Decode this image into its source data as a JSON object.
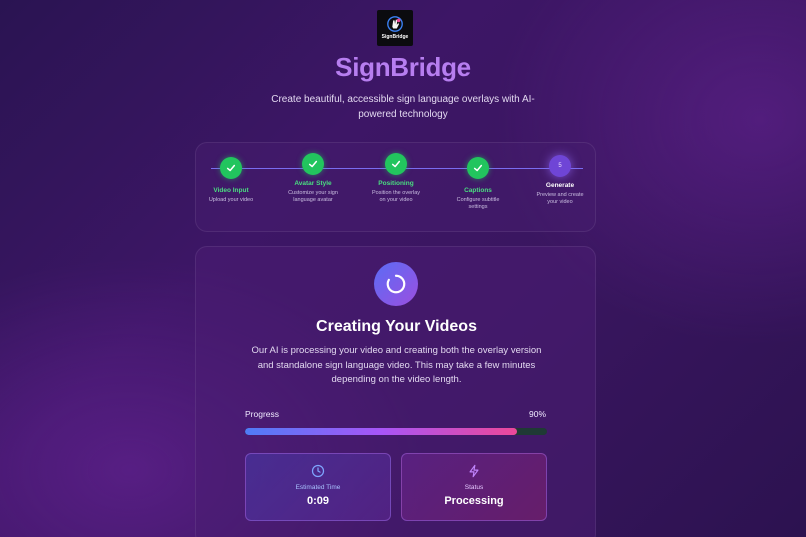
{
  "brand": {
    "logo_text": "SignBridge",
    "name": "SignBridge",
    "tagline": "Create beautiful, accessible sign language overlays with AI-powered technology"
  },
  "steps": [
    {
      "title": "Video Input",
      "desc": "Upload your video",
      "status": "complete"
    },
    {
      "title": "Avatar Style",
      "desc": "Customize your sign language avatar",
      "status": "complete"
    },
    {
      "title": "Positioning",
      "desc": "Position the overlay on your video",
      "status": "complete"
    },
    {
      "title": "Captions",
      "desc": "Configure subtitle settings",
      "status": "complete"
    },
    {
      "title": "Generate",
      "desc": "Preview and create your video",
      "status": "current",
      "number": "5"
    }
  ],
  "generation": {
    "title": "Creating Your Videos",
    "description": "Our AI is processing your video and creating both the overlay version and standalone sign language video. This may take a few minutes depending on the video length.",
    "progress_label": "Progress",
    "progress_text": "90%",
    "progress_fraction": 0.9,
    "estimated_time_label": "Estimated Time",
    "estimated_time_value": "0:09",
    "status_label": "Status",
    "status_value": "Processing"
  },
  "colors": {
    "brand": "#b77ef0",
    "step_complete": "#22c55e",
    "step_current": "#6f45d6",
    "progress_start": "#4f7cf7",
    "progress_end": "#ec4899"
  },
  "icons": {
    "logo": "hand-sign-icon",
    "step_complete": "check-icon",
    "spinner": "spinner-icon",
    "time": "clock-icon",
    "status": "lightning-icon"
  }
}
